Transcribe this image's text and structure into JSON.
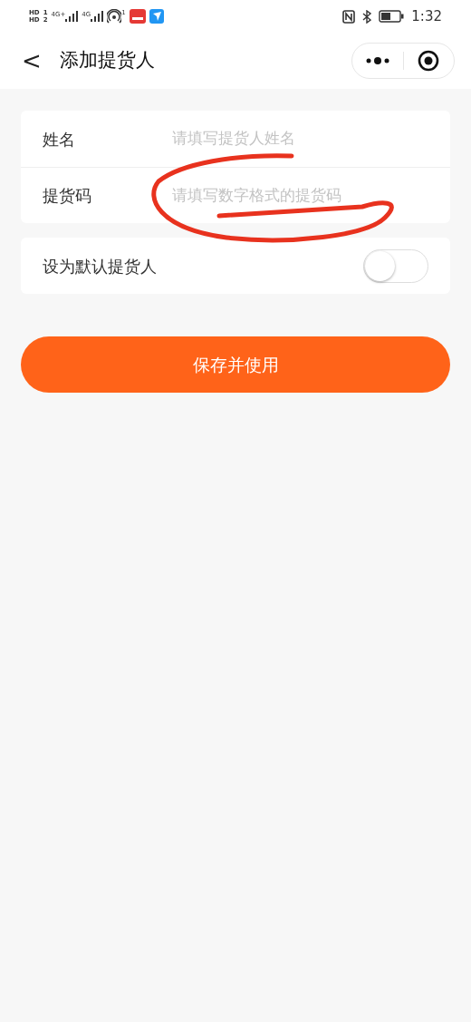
{
  "status_bar": {
    "sims": [
      {
        "badge": "HD",
        "slot": "1"
      },
      {
        "badge": "HD",
        "slot": "2"
      }
    ],
    "networks": [
      "4G+",
      "4G"
    ],
    "hotspot_count": "1",
    "time": "1:32"
  },
  "nav": {
    "back": "<",
    "title": "添加提货人"
  },
  "form": {
    "fields": [
      {
        "label": "姓名",
        "placeholder": "请填写提货人姓名"
      },
      {
        "label": "提货码",
        "placeholder": "请填写数字格式的提货码"
      }
    ],
    "default_switch": {
      "label": "设为默认提货人",
      "on": false
    }
  },
  "submit": "保存并使用",
  "annotation": {
    "kind": "scribble",
    "color": "#e8321e"
  }
}
